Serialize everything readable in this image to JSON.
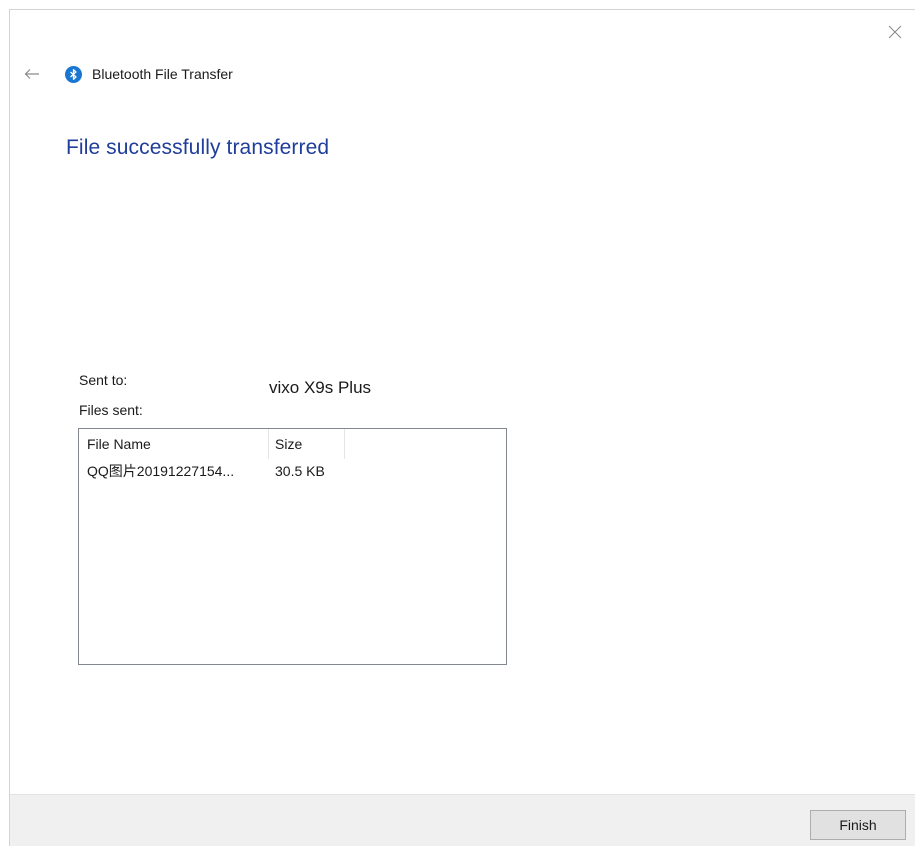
{
  "window": {
    "title": "Bluetooth File Transfer",
    "icons": {
      "back": "back-arrow-icon",
      "close": "close-icon",
      "app": "bluetooth-icon"
    }
  },
  "content": {
    "heading": "File successfully transferred",
    "sent_to_label": "Sent to:",
    "sent_to_value": "vixo X9s Plus",
    "files_sent_label": "Files sent:"
  },
  "file_list": {
    "columns": [
      "File Name",
      "Size"
    ],
    "rows": [
      {
        "name": "QQ图片20191227154...",
        "size": "30.5 KB"
      }
    ]
  },
  "footer": {
    "finish_label": "Finish"
  },
  "colors": {
    "heading": "#1f3d9a",
    "bluetooth_icon": "#1976d2",
    "footer_bg": "#f0f0f0",
    "button_bg": "#e1e1e1",
    "list_border": "#828790"
  }
}
